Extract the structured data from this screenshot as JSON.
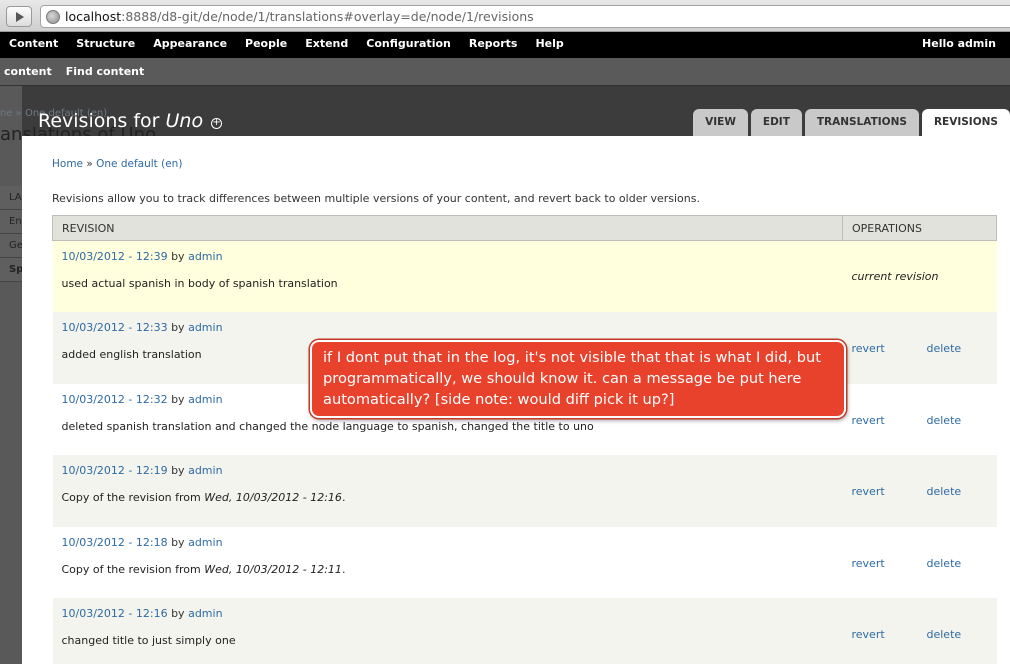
{
  "browser": {
    "url_host": "localhost",
    "url_rest": ":8888/d8-git/de/node/1/translations#overlay=de/node/1/revisions"
  },
  "toolbar": {
    "items": [
      "Content",
      "Structure",
      "Appearance",
      "People",
      "Extend",
      "Configuration",
      "Reports",
      "Help"
    ],
    "greeting": "Hello admin"
  },
  "shortcuts": [
    "content",
    "Find content"
  ],
  "background_page": {
    "breadcrumb": "ne » One default (en)",
    "title": "anslations of Uno",
    "rows": [
      "LA",
      "En",
      "Ge",
      "Sp"
    ]
  },
  "overlay": {
    "title_prefix": "Revisions for ",
    "title_node": "Uno",
    "tabs": [
      "VIEW",
      "EDIT",
      "TRANSLATIONS",
      "REVISIONS"
    ],
    "active_tab": "REVISIONS",
    "breadcrumb": {
      "home": "Home",
      "separator": " » ",
      "node": "One default (en)"
    },
    "help_text": "Revisions allow you to track differences between multiple versions of your content, and revert back to older versions.",
    "columns": {
      "revision": "REVISION",
      "operations": "OPERATIONS"
    },
    "revisions": [
      {
        "date": "10/03/2012 - 12:39",
        "by": " by ",
        "author": "admin",
        "log": "used actual spanish in body of spanish translation",
        "current": true,
        "current_label": "current revision"
      },
      {
        "date": "10/03/2012 - 12:33",
        "by": " by ",
        "author": "admin",
        "log": "added english translation",
        "revert": "revert",
        "delete": "delete"
      },
      {
        "date": "10/03/2012 - 12:32",
        "by": " by ",
        "author": "admin",
        "log": "deleted spanish translation and changed the node language to spanish, changed the title to uno",
        "revert": "revert",
        "delete": "delete"
      },
      {
        "date": "10/03/2012 - 12:19",
        "by": " by ",
        "author": "admin",
        "log_prefix": "Copy of the revision from ",
        "log_em": "Wed, 10/03/2012 - 12:16",
        "log_suffix": ".",
        "revert": "revert",
        "delete": "delete"
      },
      {
        "date": "10/03/2012 - 12:18",
        "by": " by ",
        "author": "admin",
        "log_prefix": "Copy of the revision from ",
        "log_em": "Wed, 10/03/2012 - 12:11",
        "log_suffix": ".",
        "revert": "revert",
        "delete": "delete"
      },
      {
        "date": "10/03/2012 - 12:16",
        "by": " by ",
        "author": "admin",
        "log": "changed title to just simply one",
        "revert": "revert",
        "delete": "delete"
      }
    ]
  },
  "annotation": {
    "text": "if I dont put that in the log, it's not visible that that is what I did, but programmatically, we should know it. can a message be put here automatically? [side note: would diff pick it up?]",
    "color": "#e8412c"
  }
}
